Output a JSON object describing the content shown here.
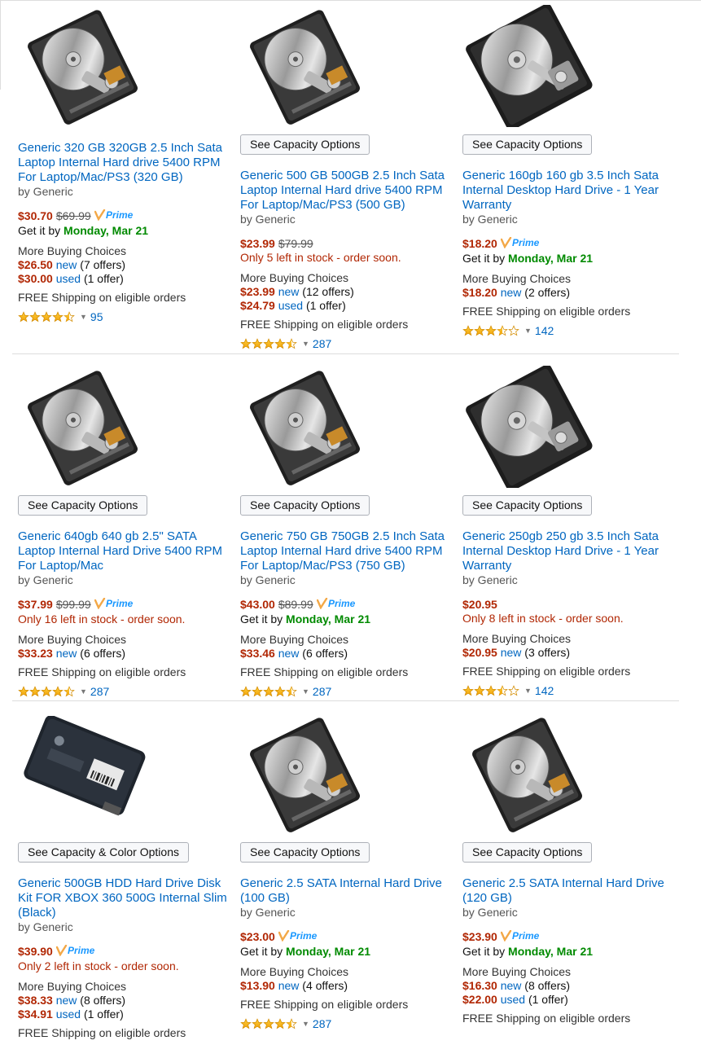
{
  "shared": {
    "by": "by Generic",
    "get_it_by": "Get it by ",
    "more_buying": "More Buying Choices",
    "free_shipping": "FREE Shipping on eligible orders",
    "new": "new",
    "used": "used",
    "prime_label": "Prime"
  },
  "products": [
    {
      "title": "Generic 320 GB 320GB 2.5 Inch Sata Laptop Internal Hard drive 5400 RPM For Laptop/Mac/PS3 (320 GB)",
      "options_button": "",
      "price": "$30.70",
      "list_price": "$69.99",
      "prime": true,
      "delivery_date": "Monday, Mar 21",
      "stock": "",
      "new_price": "$26.50",
      "new_offers": "(7 offers)",
      "used_price": "$30.00",
      "used_offers": "(1 offer)",
      "rating": 4.5,
      "reviews": "95",
      "image": "laptop-drive"
    },
    {
      "title": "Generic 500 GB 500GB 2.5 Inch Sata Laptop Internal Hard drive 5400 RPM For Laptop/Mac/PS3 (500 GB)",
      "options_button": "See Capacity Options",
      "price": "$23.99",
      "list_price": "$79.99",
      "prime": false,
      "delivery_date": "",
      "stock": "Only 5 left in stock - order soon.",
      "new_price": "$23.99",
      "new_offers": "(12 offers)",
      "used_price": "$24.79",
      "used_offers": "(1 offer)",
      "rating": 4.5,
      "reviews": "287",
      "image": "laptop-drive"
    },
    {
      "title": "Generic 160gb 160 gb 3.5 Inch Sata Internal Desktop Hard Drive - 1 Year Warranty",
      "options_button": "See Capacity Options",
      "price": "$18.20",
      "list_price": "",
      "prime": true,
      "delivery_date": "Monday, Mar 21",
      "stock": "",
      "new_price": "$18.20",
      "new_offers": "(2 offers)",
      "used_price": "",
      "used_offers": "",
      "rating": 3.5,
      "reviews": "142",
      "image": "desktop-drive"
    },
    {
      "title": "Generic 640gb 640 gb 2.5\" SATA Laptop Internal Hard Drive 5400 RPM For Laptop/Mac",
      "options_button": "See Capacity Options",
      "price": "$37.99",
      "list_price": "$99.99",
      "prime": true,
      "delivery_date": "",
      "stock": "Only 16 left in stock - order soon.",
      "new_price": "$33.23",
      "new_offers": "(6 offers)",
      "used_price": "",
      "used_offers": "",
      "rating": 4.5,
      "reviews": "287",
      "image": "laptop-drive"
    },
    {
      "title": "Generic 750 GB 750GB 2.5 Inch Sata Laptop Internal Hard drive 5400 RPM For Laptop/Mac/PS3 (750 GB)",
      "options_button": "See Capacity Options",
      "price": "$43.00",
      "list_price": "$89.99",
      "prime": true,
      "delivery_date": "Monday, Mar 21",
      "stock": "",
      "new_price": "$33.46",
      "new_offers": "(6 offers)",
      "used_price": "",
      "used_offers": "",
      "rating": 4.5,
      "reviews": "287",
      "image": "laptop-drive"
    },
    {
      "title": "Generic 250gb 250 gb 3.5 Inch Sata Internal Desktop Hard Drive - 1 Year Warranty",
      "options_button": "See Capacity Options",
      "price": "$20.95",
      "list_price": "",
      "prime": false,
      "delivery_date": "",
      "stock": "Only 8 left in stock - order soon.",
      "new_price": "$20.95",
      "new_offers": "(3 offers)",
      "used_price": "",
      "used_offers": "",
      "rating": 3.5,
      "reviews": "142",
      "image": "desktop-drive"
    },
    {
      "title": "Generic 500GB HDD Hard Drive Disk Kit FOR XBOX 360 500G Internal Slim (Black)",
      "options_button": "See Capacity & Color Options",
      "price": "$39.90",
      "list_price": "",
      "prime": true,
      "delivery_date": "",
      "stock": "Only 2 left in stock - order soon.",
      "new_price": "$38.33",
      "new_offers": "(8 offers)",
      "used_price": "$34.91",
      "used_offers": "(1 offer)",
      "rating": null,
      "reviews": "",
      "image": "xbox-drive"
    },
    {
      "title": "Generic 2.5 SATA Internal Hard Drive (100 GB)",
      "options_button": "See Capacity Options",
      "price": "$23.00",
      "list_price": "",
      "prime": true,
      "delivery_date": "Monday, Mar 21",
      "stock": "",
      "new_price": "$13.90",
      "new_offers": "(4 offers)",
      "used_price": "",
      "used_offers": "",
      "rating": 4.5,
      "reviews": "287",
      "image": "laptop-drive"
    },
    {
      "title": "Generic 2.5 SATA Internal Hard Drive (120 GB)",
      "options_button": "See Capacity Options",
      "price": "$23.90",
      "list_price": "",
      "prime": true,
      "delivery_date": "Monday, Mar 21",
      "stock": "",
      "new_price": "$16.30",
      "new_offers": "(8 offers)",
      "used_price": "$22.00",
      "used_offers": "(1 offer)",
      "rating": null,
      "reviews": "",
      "image": "laptop-drive"
    }
  ]
}
